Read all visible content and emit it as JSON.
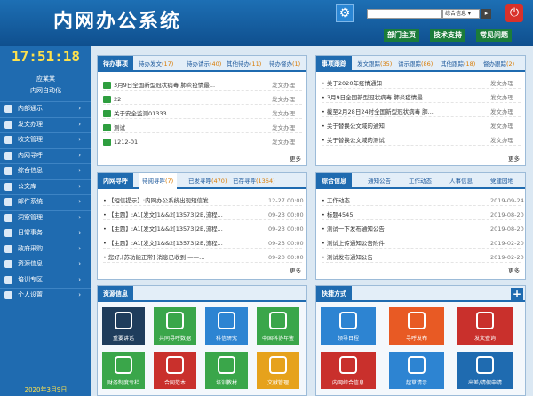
{
  "header": {
    "title": "内网办公系统",
    "search_select": "综合信息"
  },
  "toplinks": [
    "部门主页",
    "技术支持",
    "常见问题"
  ],
  "sidebar": {
    "clock": "17:51:18",
    "user": "应某某",
    "dept": "内网自动化",
    "items": [
      {
        "label": "内部通示",
        "icon": "megaphone-icon"
      },
      {
        "label": "发文办理",
        "icon": "document-icon"
      },
      {
        "label": "收文管理",
        "icon": "inbox-icon"
      },
      {
        "label": "内网寻呼",
        "icon": "mail-icon"
      },
      {
        "label": "综合信息",
        "icon": "info-icon"
      },
      {
        "label": "公文库",
        "icon": "flag-icon"
      },
      {
        "label": "邮件系统",
        "icon": "email-icon"
      },
      {
        "label": "洞察管理",
        "icon": "group-icon"
      },
      {
        "label": "日常事务",
        "icon": "clock-icon"
      },
      {
        "label": "政府采购",
        "icon": "cart-icon"
      },
      {
        "label": "资源信息",
        "icon": "resource-icon"
      },
      {
        "label": "培训专区",
        "icon": "training-icon"
      },
      {
        "label": "个人设置",
        "icon": "user-icon"
      }
    ],
    "date": "2020年3月9日"
  },
  "todo": {
    "title": "待办事项",
    "tabs": [
      {
        "label": "待办发文",
        "count": "(17)"
      },
      {
        "label": "待办请示",
        "count": "(40)"
      },
      {
        "label": "其他待办",
        "count": "(11)"
      },
      {
        "label": "待办督办",
        "count": "(1)"
      }
    ],
    "rows": [
      {
        "text": "3月9日全国新型冠状病毒 肺炎疫情最...",
        "status": "发文办理"
      },
      {
        "text": "22",
        "status": "发文办理"
      },
      {
        "text": "关于安全监测01333",
        "status": "发文办理"
      },
      {
        "text": "测试",
        "status": "发文办理"
      },
      {
        "text": "1212-01",
        "status": "发文办理"
      }
    ],
    "more": "更多"
  },
  "tracking": {
    "title": "事项跟踪",
    "tabs": [
      {
        "label": "发文跟踪",
        "count": "(35)"
      },
      {
        "label": "请示跟踪",
        "count": "(86)"
      },
      {
        "label": "其他跟踪",
        "count": "(18)"
      },
      {
        "label": "督办跟踪",
        "count": "(2)"
      }
    ],
    "rows": [
      {
        "text": "关于2020年疫情通知",
        "status": "发文办理"
      },
      {
        "text": "3月9日全国新型冠状病毒 肺炎疫情最...",
        "status": "发文办理"
      },
      {
        "text": "截至2月28日24时全国新型冠状病毒 肺...",
        "status": "发文办理"
      },
      {
        "text": "关于替换公文域的通知",
        "status": "发文办理"
      },
      {
        "text": "关于替换公文域的测试",
        "status": "发文办理"
      }
    ],
    "more": "更多"
  },
  "paging": {
    "title": "内网寻呼",
    "tabs": [
      {
        "label": "待阅寻呼",
        "count": "(7)"
      },
      {
        "label": "已发寻呼",
        "count": "(470)"
      },
      {
        "label": "已存寻呼",
        "count": "(1364)"
      }
    ],
    "rows": [
      {
        "text": "【短信提示】:内网办公系统出现短信发...",
        "date": "12-27 00:00"
      },
      {
        "text": "【主题】:A1[发文]1&&2[13573]2B,流程...",
        "date": "09-23 00:00"
      },
      {
        "text": "【主题】:A1[发文]1&&2[13573]2B,流程...",
        "date": "09-23 00:00"
      },
      {
        "text": "【主题】:A1[发文]1&&2[13573]2B,流程...",
        "date": "09-23 00:00"
      },
      {
        "text": "您好,[苏功能正常] 消息已收到 ——...",
        "date": "09-20 00:00"
      }
    ],
    "more": "更多"
  },
  "info": {
    "title": "综合信息",
    "tabs": [
      "通知公告",
      "工作动态",
      "人事信息",
      "党建园地"
    ],
    "rows": [
      {
        "text": "工作动态",
        "date": "2019-09-24"
      },
      {
        "text": "标题4545",
        "date": "2019-08-20"
      },
      {
        "text": "测试一下发布通知公告",
        "date": "2019-08-20"
      },
      {
        "text": "测试上传通知公告附件",
        "date": "2019-02-20"
      },
      {
        "text": "测试发布通知公告",
        "date": "2019-02-20"
      }
    ],
    "more": "更多"
  },
  "resources": {
    "title": "资源信息",
    "tiles": [
      {
        "label": "重要讲话",
        "color": "#1f3d5c",
        "icon": "microphone-icon"
      },
      {
        "label": "共同寻呼数据",
        "color": "#3aa64a",
        "icon": "envelope-icon"
      },
      {
        "label": "科信研究",
        "color": "#2d84d2",
        "icon": "magnifier-icon"
      },
      {
        "label": "中国科协年鉴",
        "color": "#3aa64a",
        "icon": "map-icon"
      },
      {
        "label": "财务制度专栏",
        "color": "#3aa64a",
        "icon": "bank-icon"
      },
      {
        "label": "合同范本",
        "color": "#c9302c",
        "icon": "contract-icon"
      },
      {
        "label": "培训教材",
        "color": "#3aa64a",
        "icon": "graduation-cap-icon"
      },
      {
        "label": "文献管理",
        "color": "#e6a21c",
        "icon": "books-icon"
      }
    ]
  },
  "shortcuts": {
    "title": "快捷方式",
    "tiles": [
      {
        "label": "领导日程",
        "color": "#2d84d2",
        "icon": "calendar-icon"
      },
      {
        "label": "寻呼发布",
        "color": "#e85a24",
        "icon": "send-mail-icon"
      },
      {
        "label": "发文查询",
        "color": "#c9302c",
        "icon": "document-search-icon"
      },
      {
        "label": "内网综合信息",
        "color": "#c9302c",
        "icon": "news-icon"
      },
      {
        "label": "起草请示",
        "color": "#2d84d2",
        "icon": "draft-icon"
      },
      {
        "label": "出差/请假申请",
        "color": "#1f6bb0",
        "icon": "clock-icon"
      }
    ]
  }
}
